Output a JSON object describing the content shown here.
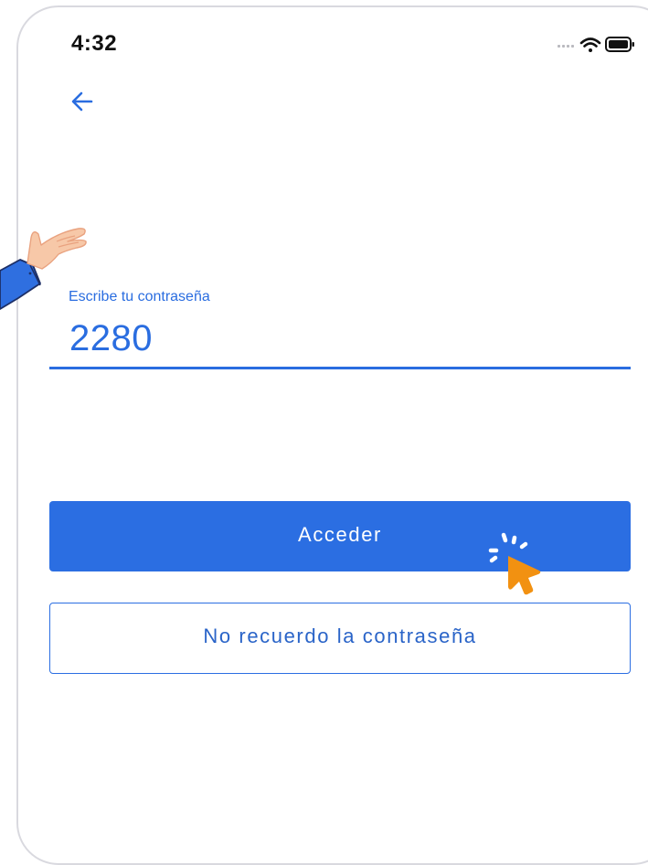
{
  "status_bar": {
    "time": "4:32",
    "icons": [
      "signal-icon",
      "wifi-icon",
      "battery-icon"
    ]
  },
  "nav": {
    "back_icon": "arrow-left-icon"
  },
  "password_field": {
    "label": "Escribe tu contraseña",
    "value": "2280"
  },
  "buttons": {
    "primary_label": "Acceder",
    "secondary_label": "No recuerdo la contraseña"
  },
  "colors": {
    "accent": "#2b6ee2",
    "cursor": "#f29111",
    "sleeve": "#2f6fe0",
    "skin": "#f7c8a8"
  }
}
